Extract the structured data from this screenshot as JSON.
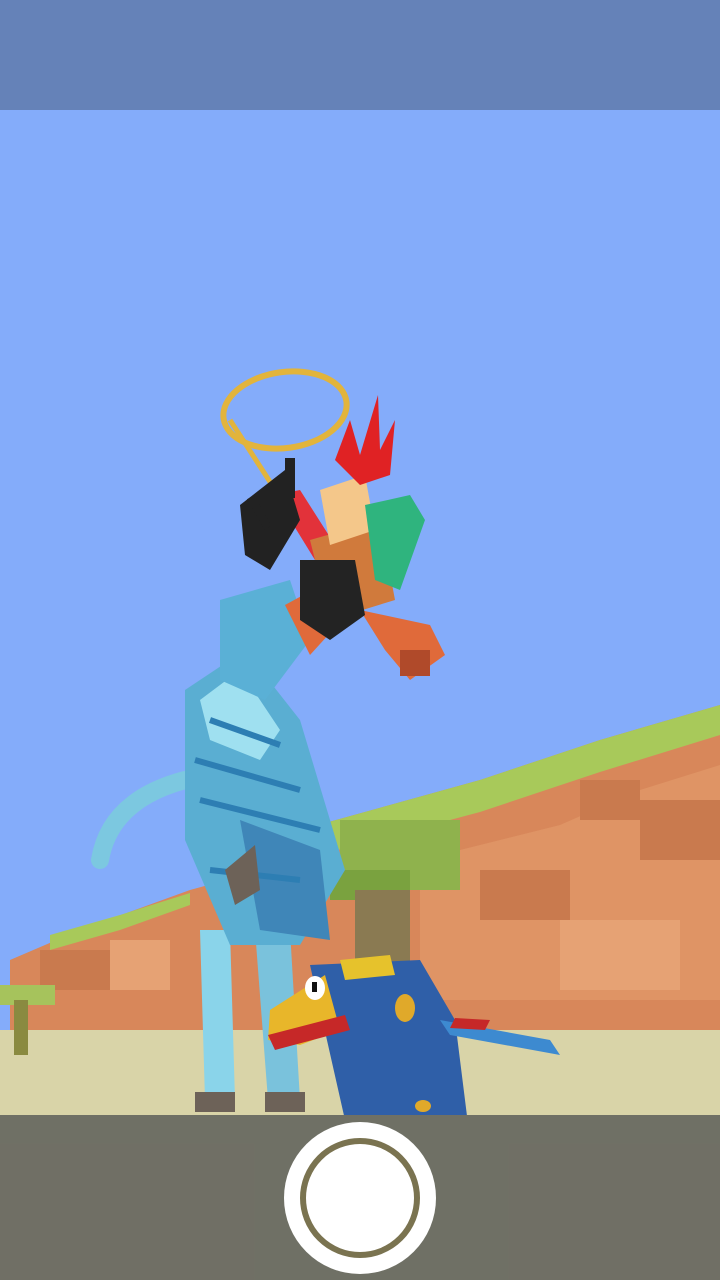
{
  "screen": {
    "top_bar_color": "#6582b8",
    "sky_color": "#84acfa",
    "bottom_bar_color": "#6e6a58",
    "canyon_color": "#d8875a",
    "grass_color": "#9fcc55",
    "ground_color": "#d9d4a8"
  },
  "characters": {
    "rider": "cowboy-rider-with-lasso",
    "mount": "blue-zebra-rearing",
    "foreground": "blue-toucan"
  },
  "controls": {
    "capture_button": "circle-shutter-icon"
  }
}
